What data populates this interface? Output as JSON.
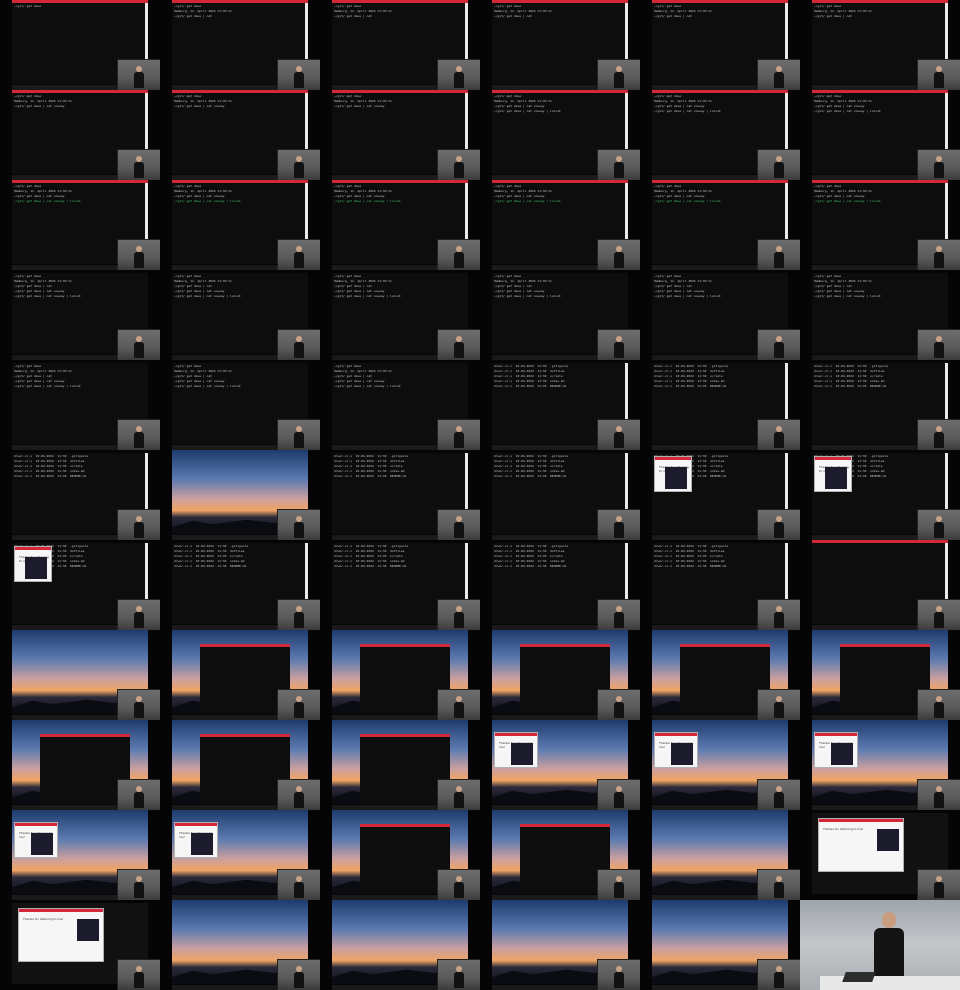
{
  "page": {
    "title": "",
    "description_visible_text": "Thanks for listening to me!"
  },
  "terminal": {
    "prompt_lines": [
      "~/git/ get dave",
      "Hamburg, 11. April 2024 11:30:11",
      "~/git/ get dave | cat",
      "~/git/ get dave | cat cowsay",
      "~/git/ get dave | cat cowsay | lolcat"
    ],
    "listing_lines": [
      "drwxr-xr-x  10.04.2024  11:30  .gitignore",
      "drwxr-xr-x  10.04.2024  11:30  dotfiles",
      "drwxr-xr-x  10.04.2024  11:30  scripts",
      "drwxr-xr-x  10.04.2024  11:30  notes.md",
      "drwxr-xr-x  10.04.2024  11:30  README.md"
    ]
  },
  "dialog": {
    "title": "Thanks for listening to me!",
    "sub": "Say hi",
    "lines": [
      "@dave",
      "github.com/dave",
      "dave.dev"
    ]
  },
  "colors": {
    "terminal_bar": "#d2283a",
    "terminal_bg": "#0d0d0d",
    "terminal_text": "#c8c8c8",
    "green_text": "#3ec46d",
    "sky_top": "#1e3b6e",
    "sky_orange": "#f1a463"
  },
  "tiles": [
    {
      "kind": "terminal",
      "lines": [
        0
      ]
    },
    {
      "kind": "terminal",
      "lines": [
        0,
        1,
        2
      ]
    },
    {
      "kind": "terminal",
      "lines": [
        0,
        1,
        2
      ]
    },
    {
      "kind": "terminal",
      "lines": [
        0,
        1,
        2
      ]
    },
    {
      "kind": "terminal",
      "lines": [
        0,
        1,
        2
      ]
    },
    {
      "kind": "terminal",
      "lines": [
        0,
        1,
        2
      ]
    },
    {
      "kind": "terminal",
      "lines": [
        0,
        1,
        3
      ]
    },
    {
      "kind": "terminal",
      "lines": [
        0,
        1,
        3
      ]
    },
    {
      "kind": "terminal",
      "lines": [
        0,
        1,
        3
      ]
    },
    {
      "kind": "terminal",
      "lines": [
        0,
        1,
        3,
        4
      ]
    },
    {
      "kind": "terminal",
      "lines": [
        0,
        1,
        3,
        4
      ]
    },
    {
      "kind": "terminal",
      "lines": [
        0,
        1,
        3,
        4
      ]
    },
    {
      "kind": "terminal",
      "lines": [
        0,
        1,
        3,
        4
      ]
    },
    {
      "kind": "terminal",
      "lines": [
        0,
        1,
        3,
        4
      ]
    },
    {
      "kind": "terminal",
      "lines": [
        0,
        1,
        3,
        4
      ]
    },
    {
      "kind": "terminal",
      "lines": [
        0,
        1,
        3,
        4
      ]
    },
    {
      "kind": "terminal",
      "lines": [
        0,
        1,
        3,
        4
      ]
    },
    {
      "kind": "terminal",
      "lines": [
        0,
        1,
        3,
        4
      ]
    },
    {
      "kind": "code"
    },
    {
      "kind": "code"
    },
    {
      "kind": "code"
    },
    {
      "kind": "code"
    },
    {
      "kind": "code"
    },
    {
      "kind": "code"
    },
    {
      "kind": "code"
    },
    {
      "kind": "code"
    },
    {
      "kind": "code"
    },
    {
      "kind": "listing"
    },
    {
      "kind": "listing"
    },
    {
      "kind": "listing"
    },
    {
      "kind": "listing"
    },
    {
      "kind": "sunset"
    },
    {
      "kind": "listing"
    },
    {
      "kind": "listing"
    },
    {
      "kind": "dialog-small"
    },
    {
      "kind": "dialog-small"
    },
    {
      "kind": "dialog-small"
    },
    {
      "kind": "listing"
    },
    {
      "kind": "listing"
    },
    {
      "kind": "listing"
    },
    {
      "kind": "listing"
    },
    {
      "kind": "terminal",
      "lines": []
    },
    {
      "kind": "sunset"
    },
    {
      "kind": "sunset-term"
    },
    {
      "kind": "sunset-term"
    },
    {
      "kind": "sunset-term"
    },
    {
      "kind": "sunset-term"
    },
    {
      "kind": "sunset-term"
    },
    {
      "kind": "sunset-term"
    },
    {
      "kind": "sunset-term"
    },
    {
      "kind": "sunset-term"
    },
    {
      "kind": "sunset-dialog"
    },
    {
      "kind": "sunset-dialog"
    },
    {
      "kind": "sunset-dialog"
    },
    {
      "kind": "sunset-dialog"
    },
    {
      "kind": "sunset-dialog"
    },
    {
      "kind": "sunset-term"
    },
    {
      "kind": "sunset-term"
    },
    {
      "kind": "sunset"
    },
    {
      "kind": "dark-dialog"
    },
    {
      "kind": "dark-dialog"
    },
    {
      "kind": "sunset"
    },
    {
      "kind": "sunset"
    },
    {
      "kind": "sunset"
    },
    {
      "kind": "sunset"
    },
    {
      "kind": "finale"
    }
  ]
}
